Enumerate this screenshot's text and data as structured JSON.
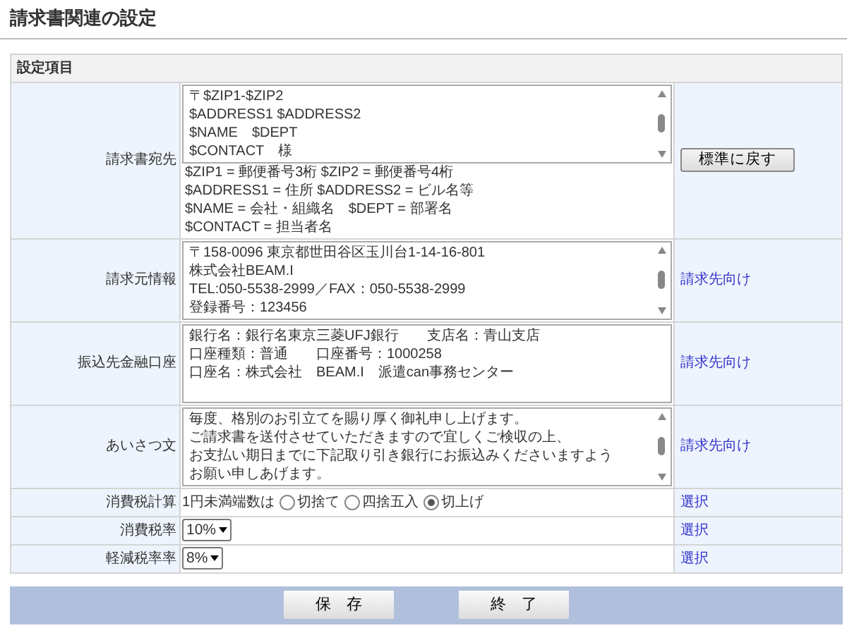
{
  "page_title": "請求書関連の設定",
  "table": {
    "header": "設定項目",
    "rows": [
      {
        "kind": "textarea",
        "label": "請求書宛先",
        "scrollbar": true,
        "lines": [
          "〒$ZIP1-$ZIP2",
          "$ADDRESS1 $ADDRESS2",
          "$NAME　$DEPT",
          "$CONTACT　様"
        ],
        "help_lines": [
          "$ZIP1 = 郵便番号3桁 $ZIP2 = 郵便番号4桁",
          "$ADDRESS1 = 住所 $ADDRESS2 = ビル名等",
          "$NAME = 会社・組織名　$DEPT = 部署名",
          "$CONTACT = 担当者名"
        ],
        "action": {
          "kind": "button",
          "text": "標準に戻す"
        }
      },
      {
        "kind": "textarea",
        "label": "請求元情報",
        "scrollbar": true,
        "lines": [
          "〒158-0096 東京都世田谷区玉川台1-14-16-801",
          "株式会社BEAM.I",
          "TEL:050-5538-2999／FAX：050-5538-2999",
          "登録番号：123456"
        ],
        "action": {
          "kind": "link",
          "text": "請求先向け"
        }
      },
      {
        "kind": "textarea",
        "label": "振込先金融口座",
        "scrollbar": false,
        "lines": [
          "銀行名：銀行名東京三菱UFJ銀行　　支店名：青山支店",
          "口座種類：普通　　口座番号：1000258",
          "口座名：株式会社　BEAM.I　派遣can事務センター"
        ],
        "action": {
          "kind": "link",
          "text": "請求先向け"
        }
      },
      {
        "kind": "textarea",
        "label": "あいさつ文",
        "scrollbar": true,
        "lines": [
          "毎度、格別のお引立てを賜り厚く御礼申し上げます。",
          "ご請求書を送付させていただきますので宜しくご検収の上、",
          "お支払い期日までに下記取り引き銀行にお振込みくださいますよう",
          "お願い申しあげます。"
        ],
        "action": {
          "kind": "link",
          "text": "請求先向け"
        }
      },
      {
        "kind": "radio",
        "label": "消費税計算",
        "prefix": "1円未満端数は",
        "options": [
          {
            "label": "切捨て",
            "selected": false
          },
          {
            "label": "四捨五入",
            "selected": false
          },
          {
            "label": "切上げ",
            "selected": true
          }
        ],
        "action": {
          "kind": "link",
          "text": "選択"
        }
      },
      {
        "kind": "select",
        "label": "消費税率",
        "value": "10%",
        "action": {
          "kind": "link",
          "text": "選択"
        }
      },
      {
        "kind": "select",
        "label": "軽減税率率",
        "value": "8%",
        "action": {
          "kind": "link",
          "text": "選択"
        }
      }
    ]
  },
  "buttons": [
    "保　存",
    "終　了"
  ]
}
